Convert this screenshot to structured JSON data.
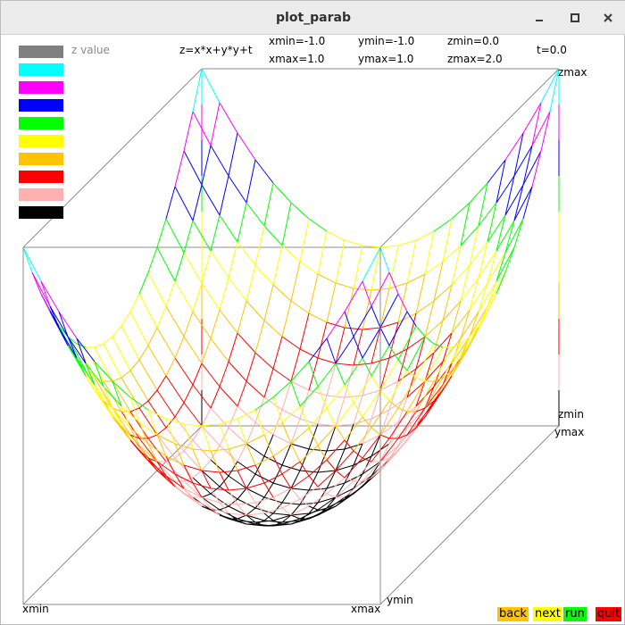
{
  "window": {
    "title": "plot_parab"
  },
  "legend": {
    "label": "z value",
    "colors": [
      "#808080",
      "#00ffff",
      "#ff00ff",
      "#0000ff",
      "#00ff00",
      "#ffff00",
      "#ffc400",
      "#ff0000",
      "#ffb0b0",
      "#000000"
    ]
  },
  "info": {
    "formula": "z=x*x+y*y+t",
    "xmin": "xmin=-1.0",
    "xmax": "xmax=1.0",
    "ymin": "ymin=-1.0",
    "ymax": "ymax=1.0",
    "zmin": "zmin=0.0",
    "zmax": "zmax=2.0",
    "t": "t=0.0"
  },
  "axes": {
    "zmax": "zmax",
    "zmin": "zmin",
    "ymax": "ymax",
    "ymin": "ymin",
    "xmin": "xmin",
    "xmax": "xmax"
  },
  "controls": [
    {
      "label": "back",
      "color": "#ffc400"
    },
    {
      "label": "next",
      "color": "#ffff00"
    },
    {
      "label": "run",
      "color": "#00ff00"
    },
    {
      "label": "quit",
      "color": "#ff0000"
    }
  ],
  "surface": {
    "function": "z=x*x+y*y",
    "x_range": [
      -1.0,
      1.0
    ],
    "y_range": [
      -1.0,
      1.0
    ],
    "z_range": [
      0.0,
      2.0
    ],
    "grid_lines": 21,
    "color_levels": [
      0.0,
      0.2,
      0.4,
      0.6,
      0.8,
      1.0,
      1.2,
      1.4,
      1.6,
      1.8,
      2.0
    ]
  }
}
